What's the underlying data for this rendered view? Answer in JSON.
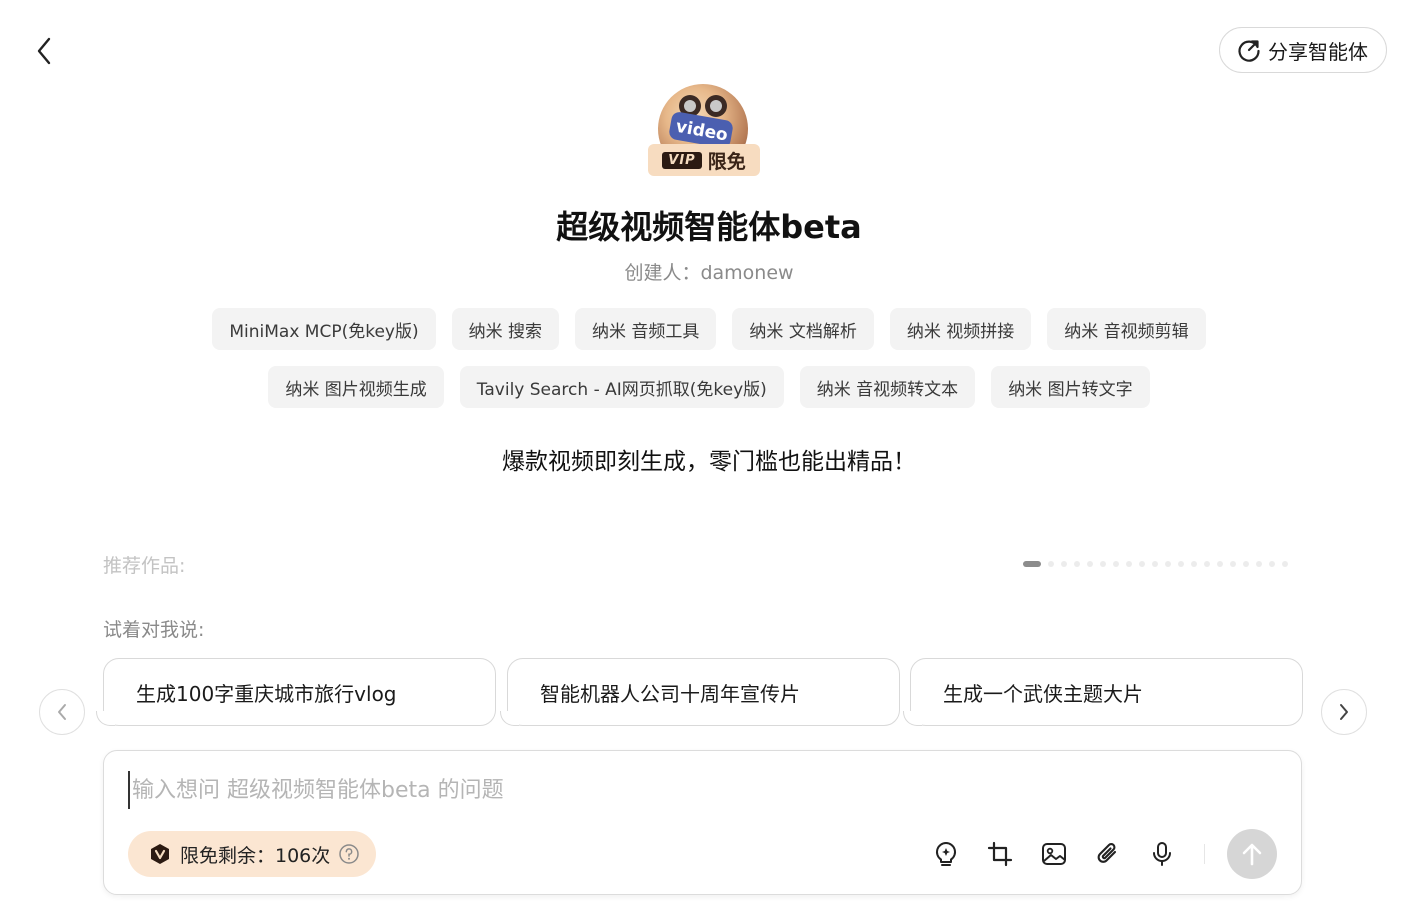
{
  "header": {
    "share_label": "分享智能体"
  },
  "agent": {
    "avatar_text": "video",
    "vip_tag": "VIP",
    "vip_label": "限免",
    "title": "超级视频智能体beta",
    "creator": "创建人：damonew",
    "tags_row1": [
      "MiniMax MCP(免key版)",
      "纳米 搜索",
      "纳米 音频工具",
      "纳米 文档解析",
      "纳米 视频拼接",
      "纳米 音视频剪辑"
    ],
    "tags_row2": [
      "纳米 图片视频生成",
      "Tavily Search - AI网页抓取(免key版)",
      "纳米 音视频转文本",
      "纳米 图片转文字"
    ],
    "slogan": "爆款视频即刻生成，零门槛也能出精品！"
  },
  "recommend": {
    "label": "推荐作品:",
    "page_count": 20,
    "active_page": 1
  },
  "try": {
    "label": "试着对我说:",
    "suggestions": [
      "生成100字重庆城市旅行vlog",
      "智能机器人公司十周年宣传片",
      "生成一个武侠主题大片"
    ]
  },
  "input": {
    "placeholder": "输入想问 超级视频智能体beta 的问题",
    "value": "",
    "quota_label": "限免剩余：106次"
  },
  "colors": {
    "accent_bg": "#fbe6d2",
    "vip_dark": "#2b1a12",
    "tag_bg": "#f3f3f3",
    "send_disabled": "#d6d6d6"
  }
}
